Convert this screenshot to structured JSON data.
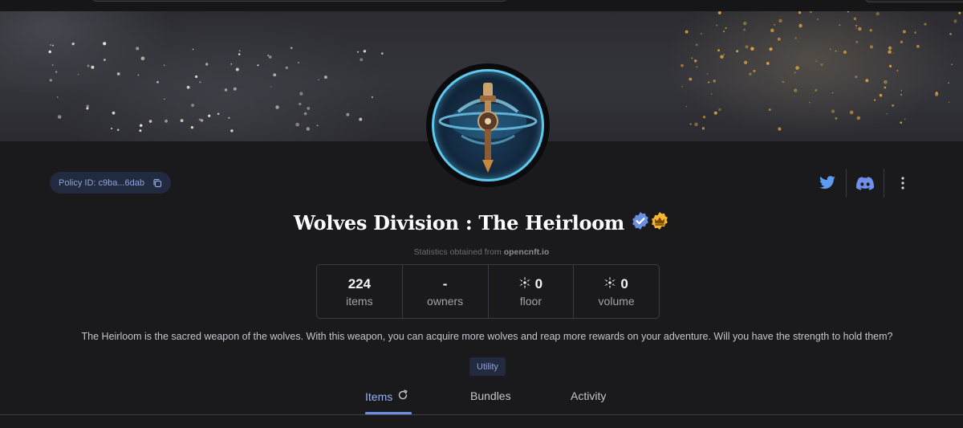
{
  "collection": {
    "policy_label": "Policy ID: c9ba...6dab",
    "title": "Wolves Division : The Heirloom",
    "stats_source_prefix": "Statistics obtained from",
    "stats_source_name": "opencnft.io",
    "description": "The Heirloom is the sacred weapon of the wolves. With this weapon, you can acquire more wolves and reap more rewards on your adventure. Will you have the strength to hold them?",
    "tag": "Utility"
  },
  "stats": [
    {
      "value": "224",
      "label": "items"
    },
    {
      "value": "-",
      "label": "owners"
    },
    {
      "value": "0",
      "label": "floor"
    },
    {
      "value": "0",
      "label": "volume"
    }
  ],
  "tabs": [
    {
      "label": "Items"
    },
    {
      "label": "Bundles"
    },
    {
      "label": "Activity"
    }
  ],
  "icons": {
    "verified": "verified-badge-icon",
    "crown": "crown-badge-icon",
    "twitter": "twitter-icon",
    "discord": "discord-icon",
    "more": "more-vertical-icon",
    "copy": "copy-icon",
    "refresh": "refresh-icon",
    "ada": "cardano-ada-icon"
  },
  "colors": {
    "accent": "#6d8fe6",
    "twitter": "#5b9cf0",
    "discord": "#6f8fe8",
    "verified": "#6b8fe0",
    "crown": "#f5b731"
  }
}
